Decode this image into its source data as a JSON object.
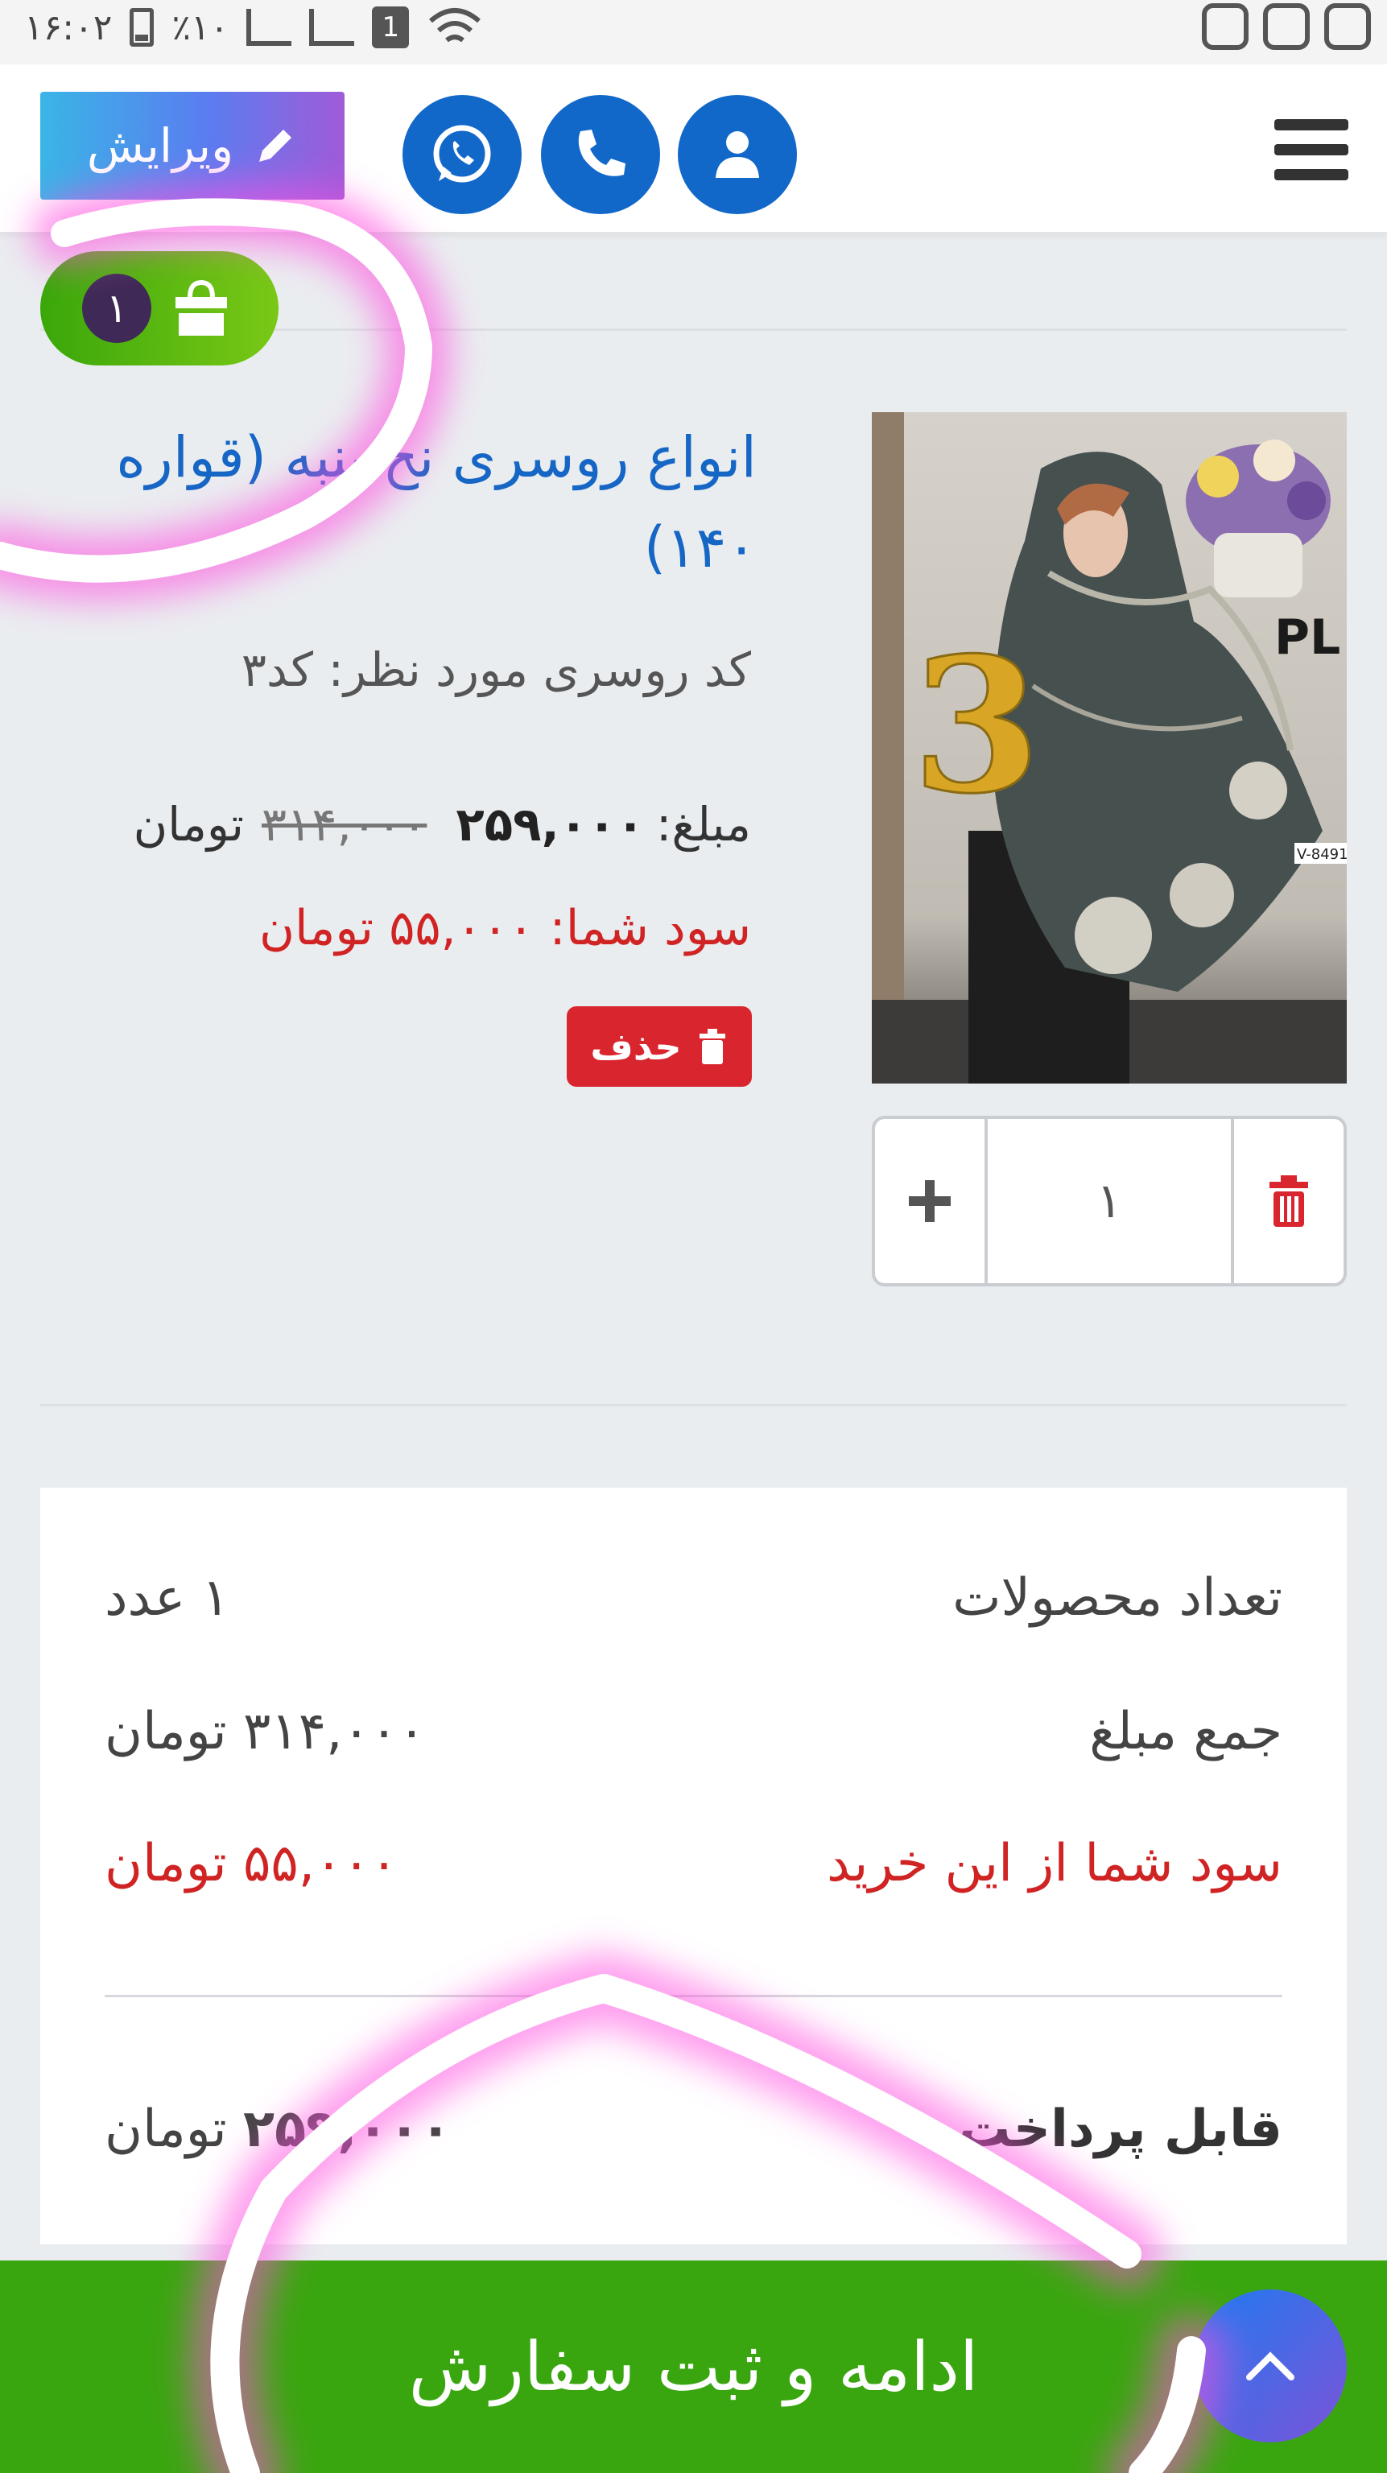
{
  "status_bar": {
    "time": "۱۶:۰۲",
    "battery": "٪۱۰",
    "sim": "1"
  },
  "header": {
    "edit_label": "ویرایش",
    "icons": [
      "user-icon",
      "phone-icon",
      "whatsapp-icon",
      "menu-icon",
      "pencil-icon"
    ]
  },
  "cart": {
    "count": "۱",
    "icon": "shopping-bag-icon"
  },
  "product": {
    "title": "انواع روسری نخ پنبه (قواره ۱۴۰)",
    "code_line": "کد روسری مورد نظر: کد۳",
    "price_label": "مبلغ:",
    "old_price": "۳۱۴,۰۰۰",
    "new_price": "۲۵۹,۰۰۰",
    "currency": "تومان",
    "savings_line": "سود شما: ۵۵,۰۰۰ تومان",
    "delete_label": "حذف",
    "image_number": "3",
    "image_brand": "PL",
    "image_code": "V-8491-"
  },
  "quantity": {
    "value": "۱"
  },
  "summary": {
    "count_label": "تعداد محصولات",
    "count_value": "۱ عدد",
    "sum_label": "جمع مبلغ",
    "sum_value": "۳۱۴,۰۰۰ تومان",
    "profit_label": "سود شما از این خرید",
    "profit_value": "۵۵,۰۰۰ تومان",
    "payable_label": "قابل پرداخت",
    "payable_amount": "۲۵۹,۰۰۰",
    "payable_currency": "تومان"
  },
  "checkout": {
    "label": "ادامه و ثبت سفارش"
  },
  "colors": {
    "primary_blue": "#1268c9",
    "green": "#3aa60f",
    "red": "#d9262e",
    "highlight": "#ff4fe0"
  }
}
